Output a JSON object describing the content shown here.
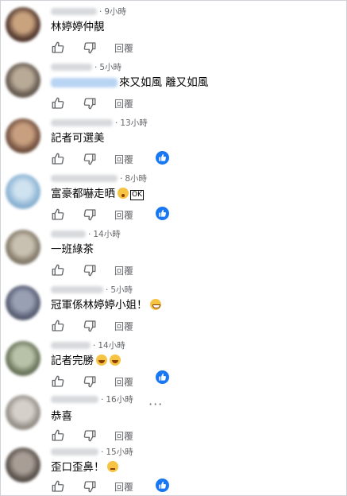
{
  "labels": {
    "reply": "回覆"
  },
  "colors": {
    "like_badge": "#1877f2",
    "meta_text": "#65676b",
    "text": "#050505"
  },
  "comments": [
    {
      "time": "9小時",
      "text": "林婷婷仲靚"
    },
    {
      "time": "5小時",
      "text": "來又如風 離又如風"
    },
    {
      "time": "13小時",
      "text": "記者可選美"
    },
    {
      "time": "8小時",
      "text": "富豪都嚇走晒",
      "boxed": "OK"
    },
    {
      "time": "14小時",
      "text": "一班綠茶"
    },
    {
      "time": "5小時",
      "text": "冠軍係林婷婷小姐！"
    },
    {
      "time": "14小時",
      "text": "記者完勝"
    },
    {
      "time": "16小時",
      "text": "恭喜"
    },
    {
      "time": "15小時",
      "text": "歪口歪鼻！"
    }
  ]
}
